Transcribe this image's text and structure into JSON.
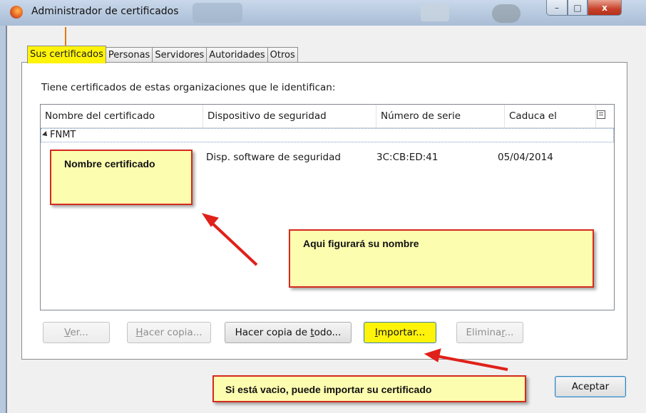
{
  "window": {
    "title": "Administrador de certificados",
    "controls": {
      "minimize": "–",
      "maximize": "□",
      "close": "x"
    }
  },
  "tabs": [
    {
      "label": "Sus certificados",
      "active": true,
      "highlight": "#fff30a"
    },
    {
      "label": "Personas",
      "active": false
    },
    {
      "label": "Servidores",
      "active": false
    },
    {
      "label": "Autoridades",
      "active": false
    },
    {
      "label": "Otros",
      "active": false
    }
  ],
  "panel": {
    "lead_text": "Tiene certificados de estas organizaciones que le identifican:",
    "columns": [
      "Nombre del certificado",
      "Dispositivo de seguridad",
      "Número de serie",
      "Caduca el"
    ],
    "groups": [
      {
        "name": "FNMT",
        "rows": [
          {
            "name": "",
            "device": "Disp. software de seguridad",
            "serial": "3C:CB:ED:41",
            "expires": "05/04/2014"
          }
        ]
      }
    ]
  },
  "buttons": {
    "view": {
      "label": "Ver...",
      "mnemonic": "V",
      "enabled": false
    },
    "backup": {
      "label": "Hacer copia...",
      "mnemonic": "H",
      "enabled": false
    },
    "backup_all": {
      "label": "Hacer copia de todo...",
      "mnemonic": "t",
      "enabled": true
    },
    "import": {
      "label": "Importar...",
      "mnemonic": "I",
      "enabled": true
    },
    "delete": {
      "label": "Eliminar...",
      "mnemonic": "r",
      "enabled": false
    },
    "accept": {
      "label": "Aceptar",
      "enabled": true
    }
  },
  "annotations": {
    "name_box": "Nombre certificado",
    "name_hint": "Aqui figurará su nombre",
    "import_hint": "Si está vacio, puede importar su certificado"
  },
  "colors": {
    "highlight_yellow": "#fff30a",
    "note_fill": "#fdfdb0",
    "note_border": "#d42a1e",
    "arrow_red": "#e0201a"
  }
}
